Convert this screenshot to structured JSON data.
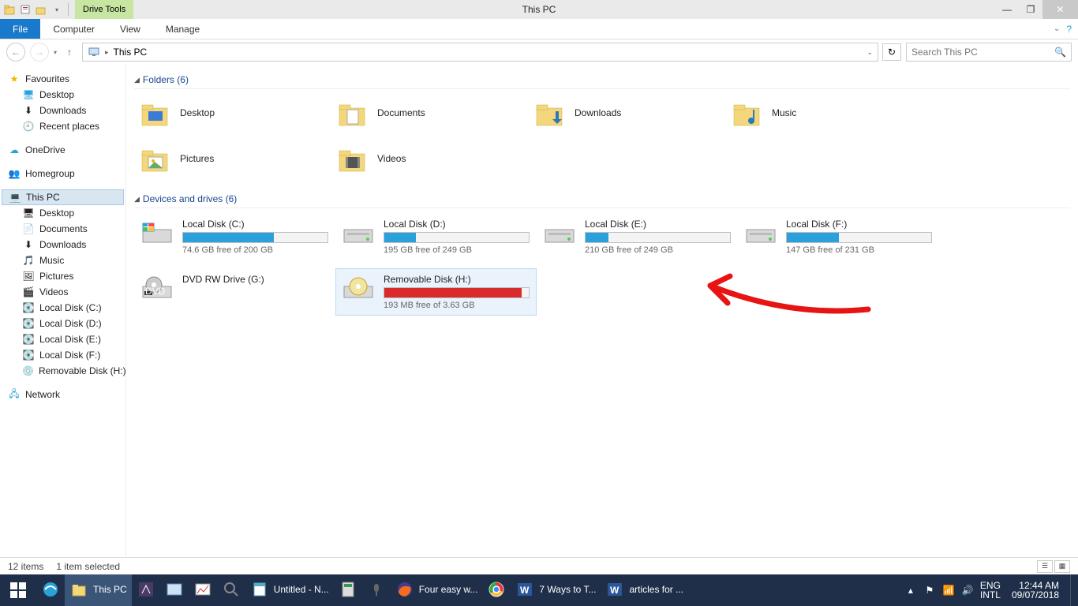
{
  "window": {
    "title": "This PC",
    "drive_tools_label": "Drive Tools"
  },
  "ribbon": {
    "file": "File",
    "computer": "Computer",
    "view": "View",
    "manage": "Manage"
  },
  "address": {
    "location": "This PC",
    "search_placeholder": "Search This PC"
  },
  "sidebar": {
    "favourites": {
      "label": "Favourites",
      "items": [
        "Desktop",
        "Downloads",
        "Recent places"
      ]
    },
    "onedrive": "OneDrive",
    "homegroup": "Homegroup",
    "thispc": {
      "label": "This PC",
      "items": [
        "Desktop",
        "Documents",
        "Downloads",
        "Music",
        "Pictures",
        "Videos",
        "Local Disk (C:)",
        "Local Disk (D:)",
        "Local Disk (E:)",
        "Local Disk (F:)",
        "Removable Disk (H:)"
      ]
    },
    "network": "Network"
  },
  "sections": {
    "folders_header": "Folders (6)",
    "drives_header": "Devices and drives (6)"
  },
  "folders": [
    {
      "name": "Desktop"
    },
    {
      "name": "Documents"
    },
    {
      "name": "Downloads"
    },
    {
      "name": "Music"
    },
    {
      "name": "Pictures"
    },
    {
      "name": "Videos"
    }
  ],
  "drives": [
    {
      "name": "Local Disk (C:)",
      "free": "74.6 GB free of 200 GB",
      "pct": 63,
      "color": "blue"
    },
    {
      "name": "Local Disk (D:)",
      "free": "195 GB free of 249 GB",
      "pct": 22,
      "color": "blue"
    },
    {
      "name": "Local Disk (E:)",
      "free": "210 GB free of 249 GB",
      "pct": 16,
      "color": "blue"
    },
    {
      "name": "Local Disk (F:)",
      "free": "147 GB free of 231 GB",
      "pct": 36,
      "color": "blue"
    },
    {
      "name": "DVD RW Drive (G:)",
      "free": "",
      "pct": null,
      "color": "",
      "nobar": true
    },
    {
      "name": "Removable Disk (H:)",
      "free": "193 MB free of 3.63 GB",
      "pct": 95,
      "color": "red",
      "selected": true
    }
  ],
  "statusbar": {
    "items": "12 items",
    "selected": "1 item selected"
  },
  "taskbar": {
    "items": [
      {
        "label": "",
        "icon": "ie"
      },
      {
        "label": "This PC",
        "icon": "explorer",
        "active": true
      },
      {
        "label": "",
        "icon": "app1"
      },
      {
        "label": "",
        "icon": "app2"
      },
      {
        "label": "",
        "icon": "stats"
      },
      {
        "label": "",
        "icon": "magnify"
      },
      {
        "label": "Untitled - N...",
        "icon": "notepad"
      },
      {
        "label": "",
        "icon": "calc"
      },
      {
        "label": "",
        "icon": "mic"
      },
      {
        "label": "Four easy w...",
        "icon": "firefox"
      },
      {
        "label": "",
        "icon": "chrome"
      },
      {
        "label": "7 Ways to T...",
        "icon": "word"
      },
      {
        "label": "articles for ...",
        "icon": "word"
      }
    ],
    "lang1": "ENG",
    "lang2": "INTL",
    "time": "12:44 AM",
    "date": "09/07/2018"
  }
}
